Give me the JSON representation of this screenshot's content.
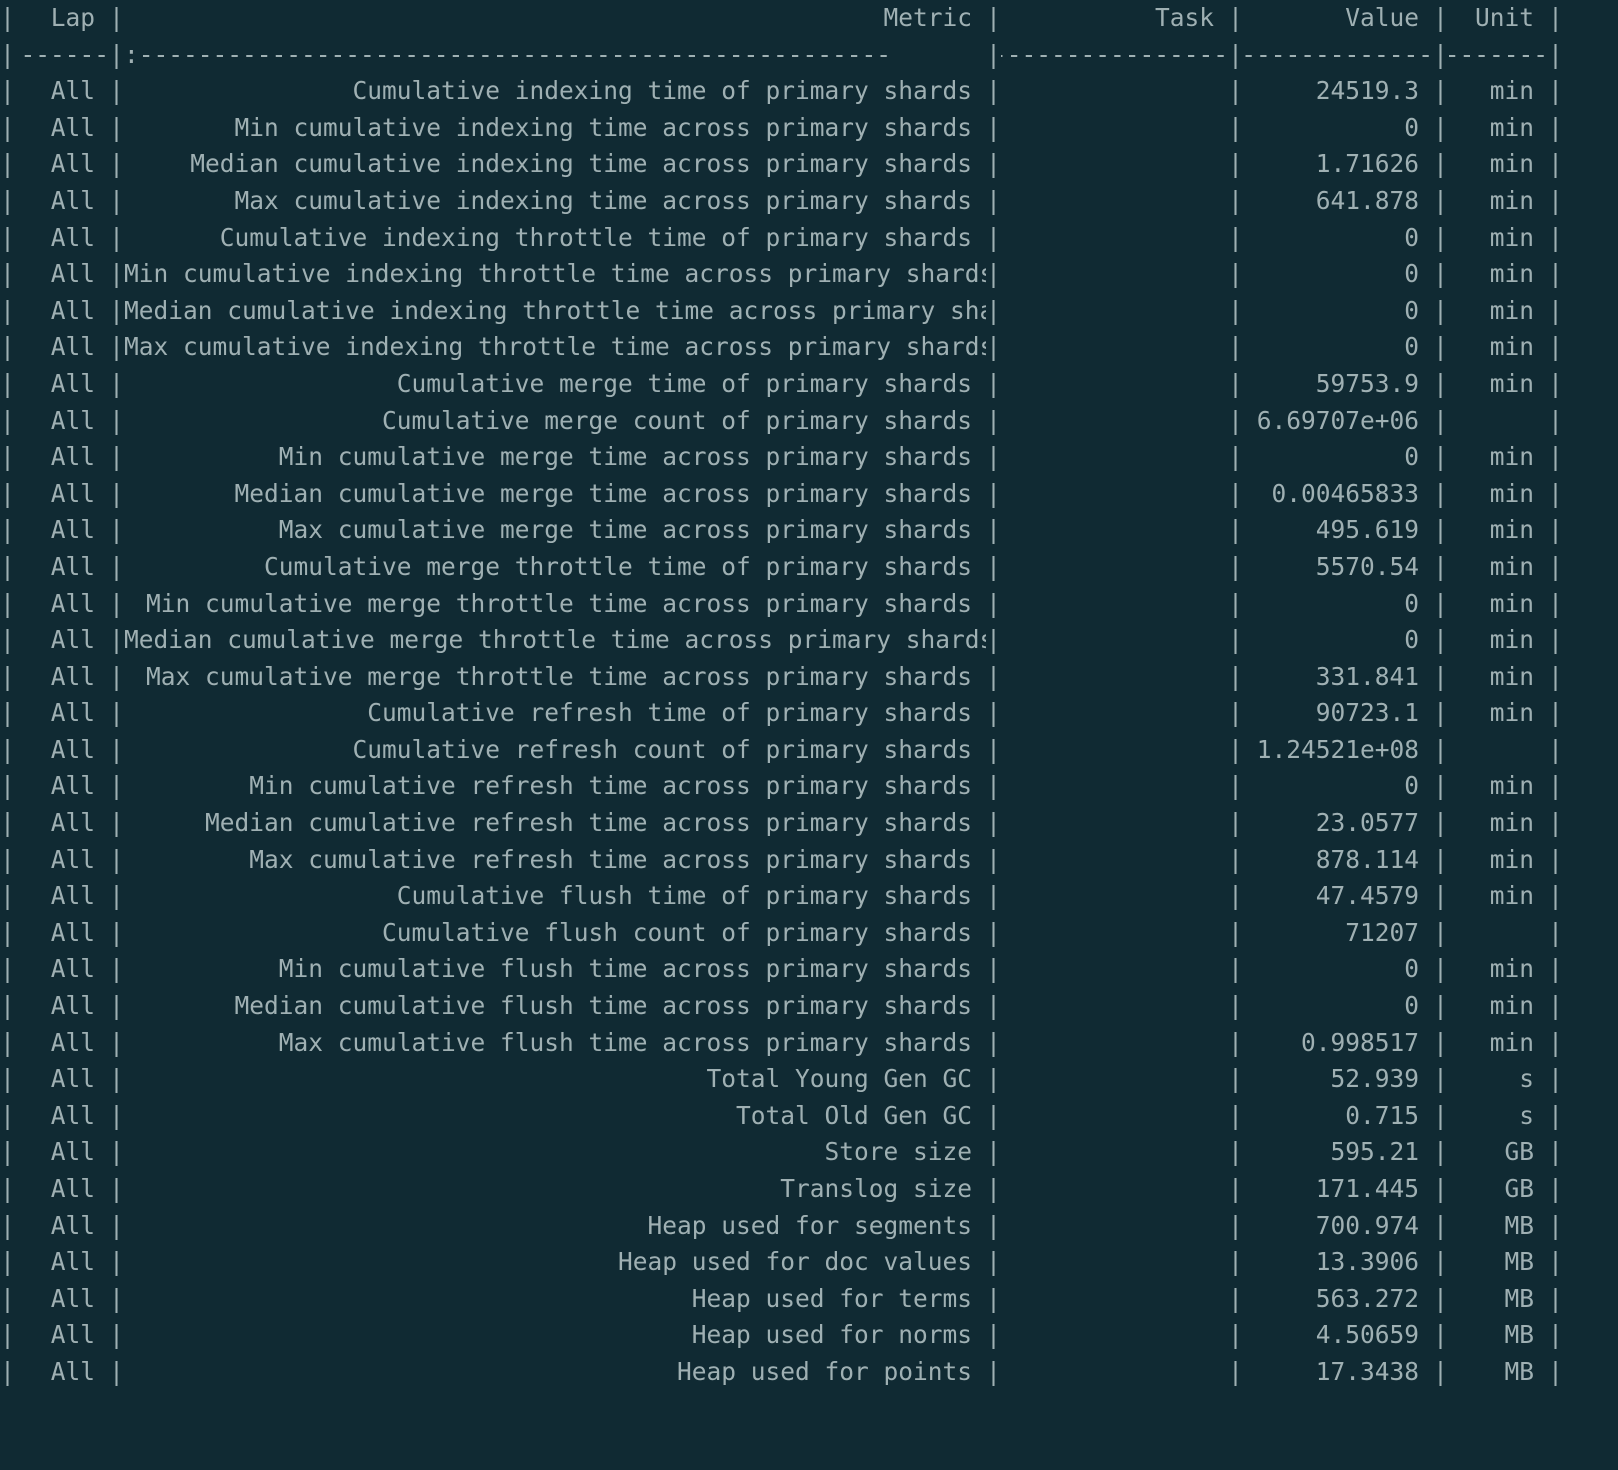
{
  "terminal": {
    "background_color": "#102a33",
    "text_color": "#9fb0b3"
  },
  "table": {
    "headers": {
      "lap": "Lap",
      "metric": "Metric",
      "task": "Task",
      "value": "Value",
      "unit": "Unit"
    },
    "separator": {
      "lap": "------:",
      "metric": "---------------------------------------------------:",
      "task": "------------------:",
      "value": "-------------:",
      "unit": "-------:"
    },
    "rows": [
      {
        "lap": "All",
        "metric": "Cumulative indexing time of primary shards",
        "task": "",
        "value": "24519.3",
        "unit": "min"
      },
      {
        "lap": "All",
        "metric": "Min cumulative indexing time across primary shards",
        "task": "",
        "value": "0",
        "unit": "min"
      },
      {
        "lap": "All",
        "metric": "Median cumulative indexing time across primary shards",
        "task": "",
        "value": "1.71626",
        "unit": "min"
      },
      {
        "lap": "All",
        "metric": "Max cumulative indexing time across primary shards",
        "task": "",
        "value": "641.878",
        "unit": "min"
      },
      {
        "lap": "All",
        "metric": "Cumulative indexing throttle time of primary shards",
        "task": "",
        "value": "0",
        "unit": "min"
      },
      {
        "lap": "All",
        "metric": "Min cumulative indexing throttle time across primary shards",
        "task": "",
        "value": "0",
        "unit": "min"
      },
      {
        "lap": "All",
        "metric": "Median cumulative indexing throttle time across primary shards",
        "task": "",
        "value": "0",
        "unit": "min"
      },
      {
        "lap": "All",
        "metric": "Max cumulative indexing throttle time across primary shards",
        "task": "",
        "value": "0",
        "unit": "min"
      },
      {
        "lap": "All",
        "metric": "Cumulative merge time of primary shards",
        "task": "",
        "value": "59753.9",
        "unit": "min"
      },
      {
        "lap": "All",
        "metric": "Cumulative merge count of primary shards",
        "task": "",
        "value": "6.69707e+06",
        "unit": ""
      },
      {
        "lap": "All",
        "metric": "Min cumulative merge time across primary shards",
        "task": "",
        "value": "0",
        "unit": "min"
      },
      {
        "lap": "All",
        "metric": "Median cumulative merge time across primary shards",
        "task": "",
        "value": "0.00465833",
        "unit": "min"
      },
      {
        "lap": "All",
        "metric": "Max cumulative merge time across primary shards",
        "task": "",
        "value": "495.619",
        "unit": "min"
      },
      {
        "lap": "All",
        "metric": "Cumulative merge throttle time of primary shards",
        "task": "",
        "value": "5570.54",
        "unit": "min"
      },
      {
        "lap": "All",
        "metric": "Min cumulative merge throttle time across primary shards",
        "task": "",
        "value": "0",
        "unit": "min"
      },
      {
        "lap": "All",
        "metric": "Median cumulative merge throttle time across primary shards",
        "task": "",
        "value": "0",
        "unit": "min"
      },
      {
        "lap": "All",
        "metric": "Max cumulative merge throttle time across primary shards",
        "task": "",
        "value": "331.841",
        "unit": "min"
      },
      {
        "lap": "All",
        "metric": "Cumulative refresh time of primary shards",
        "task": "",
        "value": "90723.1",
        "unit": "min"
      },
      {
        "lap": "All",
        "metric": "Cumulative refresh count of primary shards",
        "task": "",
        "value": "1.24521e+08",
        "unit": ""
      },
      {
        "lap": "All",
        "metric": "Min cumulative refresh time across primary shards",
        "task": "",
        "value": "0",
        "unit": "min"
      },
      {
        "lap": "All",
        "metric": "Median cumulative refresh time across primary shards",
        "task": "",
        "value": "23.0577",
        "unit": "min"
      },
      {
        "lap": "All",
        "metric": "Max cumulative refresh time across primary shards",
        "task": "",
        "value": "878.114",
        "unit": "min"
      },
      {
        "lap": "All",
        "metric": "Cumulative flush time of primary shards",
        "task": "",
        "value": "47.4579",
        "unit": "min"
      },
      {
        "lap": "All",
        "metric": "Cumulative flush count of primary shards",
        "task": "",
        "value": "71207",
        "unit": ""
      },
      {
        "lap": "All",
        "metric": "Min cumulative flush time across primary shards",
        "task": "",
        "value": "0",
        "unit": "min"
      },
      {
        "lap": "All",
        "metric": "Median cumulative flush time across primary shards",
        "task": "",
        "value": "0",
        "unit": "min"
      },
      {
        "lap": "All",
        "metric": "Max cumulative flush time across primary shards",
        "task": "",
        "value": "0.998517",
        "unit": "min"
      },
      {
        "lap": "All",
        "metric": "Total Young Gen GC",
        "task": "",
        "value": "52.939",
        "unit": "s"
      },
      {
        "lap": "All",
        "metric": "Total Old Gen GC",
        "task": "",
        "value": "0.715",
        "unit": "s"
      },
      {
        "lap": "All",
        "metric": "Store size",
        "task": "",
        "value": "595.21",
        "unit": "GB"
      },
      {
        "lap": "All",
        "metric": "Translog size",
        "task": "",
        "value": "171.445",
        "unit": "GB"
      },
      {
        "lap": "All",
        "metric": "Heap used for segments",
        "task": "",
        "value": "700.974",
        "unit": "MB"
      },
      {
        "lap": "All",
        "metric": "Heap used for doc values",
        "task": "",
        "value": "13.3906",
        "unit": "MB"
      },
      {
        "lap": "All",
        "metric": "Heap used for terms",
        "task": "",
        "value": "563.272",
        "unit": "MB"
      },
      {
        "lap": "All",
        "metric": "Heap used for norms",
        "task": "",
        "value": "4.50659",
        "unit": "MB"
      },
      {
        "lap": "All",
        "metric": "Heap used for points",
        "task": "",
        "value": "17.3438",
        "unit": "MB"
      }
    ]
  }
}
